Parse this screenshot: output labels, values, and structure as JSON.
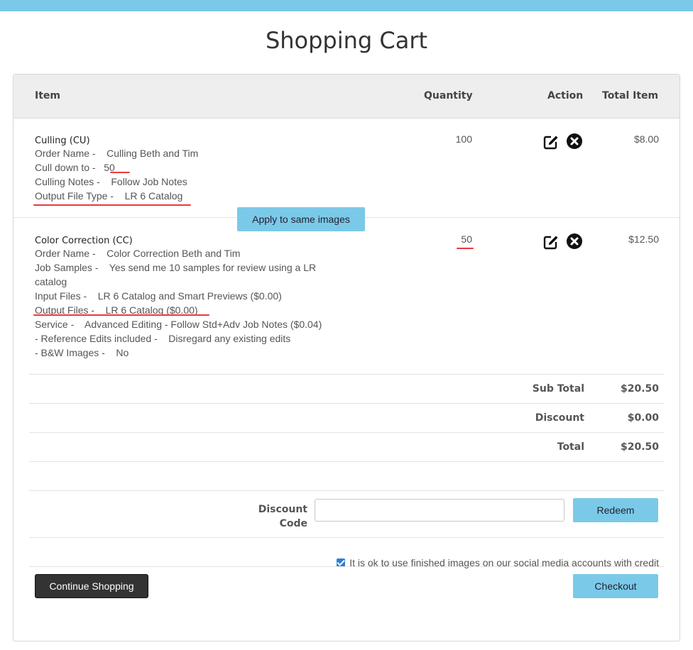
{
  "page": {
    "title": "Shopping Cart"
  },
  "table": {
    "headers": {
      "item": "Item",
      "quantity": "Quantity",
      "action": "Action",
      "total": "Total Item"
    }
  },
  "items": [
    {
      "title": "Culling (CU)",
      "lines": [
        "Order Name -    Culling Beth and Tim",
        "Cull down to -   50",
        "Culling Notes -    Follow Job Notes",
        "Output File Type -    LR 6 Catalog"
      ],
      "quantity": "100",
      "total": "$8.00"
    },
    {
      "title": "Color Correction (CC)",
      "lines": [
        "Order Name -    Color Correction Beth and Tim",
        "Job Samples -    Yes send me 10 samples for review using a LR",
        "catalog",
        "Input Files -    LR 6 Catalog and Smart Previews ($0.00)",
        "Output Files -    LR 6 Catalog ($0.00)",
        "Service -    Advanced Editing - Follow Std+Adv Job Notes ($0.04)",
        "- Reference Edits included -    Disregard any existing edits",
        "- B&W Images -    No"
      ],
      "quantity": "50",
      "total": "$12.50"
    }
  ],
  "apply_button": "Apply to same images",
  "summary": {
    "subtotal_label": "Sub Total",
    "subtotal": "$20.50",
    "discount_label": "Discount",
    "discount": "$0.00",
    "total_label": "Total",
    "total": "$20.50"
  },
  "discount_code": {
    "label_line1": "Discount",
    "label_line2": "Code",
    "value": "",
    "placeholder": "",
    "button": "Redeem"
  },
  "consent": {
    "checked": true,
    "text": "It is ok to use finished images on our social media accounts with credit"
  },
  "footer": {
    "continue": "Continue Shopping",
    "checkout": "Checkout"
  },
  "colors": {
    "accent": "#7bc9e8",
    "annotation": "#ea3a3a",
    "dark_button": "#333333",
    "checkbox": "#2f7fd8"
  },
  "icons": {
    "edit": "edit-square-icon",
    "remove": "remove-circle-x-icon"
  }
}
